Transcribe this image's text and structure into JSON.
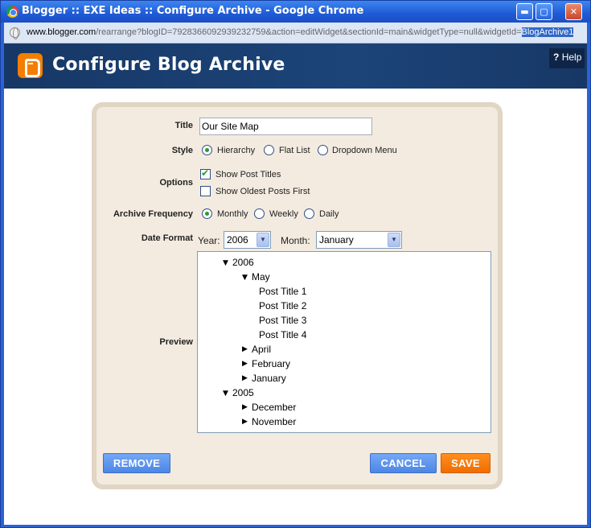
{
  "window": {
    "title": "Blogger :: EXE Ideas :: Configure Archive - Google Chrome",
    "min_icon": "minimize-icon",
    "max_icon": "maximize-icon",
    "close_icon": "close-icon"
  },
  "address": {
    "host": "www.blogger.com",
    "path": "/rearrange?blogID=7928366092939232759&action=editWidget&sectionId=main&widgetType=null&widgetId=",
    "selected": "BlogArchive1"
  },
  "header": {
    "title": "Configure Blog Archive",
    "help_mark": "?",
    "help_label": "Help",
    "logo_color": "#f57d00",
    "band_color": "#1a3c70"
  },
  "form": {
    "title_label": "Title",
    "title_value": "Our Site Map",
    "style_label": "Style",
    "style_options": [
      "Hierarchy",
      "Flat List",
      "Dropdown Menu"
    ],
    "style_selected": "Hierarchy",
    "options_label": "Options",
    "option_items": [
      {
        "label": "Show Post Titles",
        "checked": true
      },
      {
        "label": "Show Oldest Posts First",
        "checked": false
      }
    ],
    "frequency_label": "Archive Frequency",
    "frequency_options": [
      "Monthly",
      "Weekly",
      "Daily"
    ],
    "frequency_selected": "Monthly",
    "date_format_label": "Date Format",
    "year_label": "Year:",
    "year_value": "2006",
    "month_label": "Month:",
    "month_value": "January",
    "preview_label": "Preview"
  },
  "preview": {
    "items": [
      {
        "text": "2006",
        "expanded": true
      },
      {
        "text": "May",
        "expanded": true
      },
      {
        "text": "Post Title 1"
      },
      {
        "text": "Post Title 2"
      },
      {
        "text": "Post Title 3"
      },
      {
        "text": "Post Title 4"
      },
      {
        "text": "April",
        "expanded": false
      },
      {
        "text": "February",
        "expanded": false
      },
      {
        "text": "January",
        "expanded": false
      },
      {
        "text": "2005",
        "expanded": true
      },
      {
        "text": "December",
        "expanded": false
      },
      {
        "text": "November",
        "expanded": false
      }
    ]
  },
  "buttons": {
    "remove": "REMOVE",
    "cancel": "CANCEL",
    "save": "SAVE",
    "blue_color": "#5a92ee",
    "orange_color": "#f57d00"
  }
}
